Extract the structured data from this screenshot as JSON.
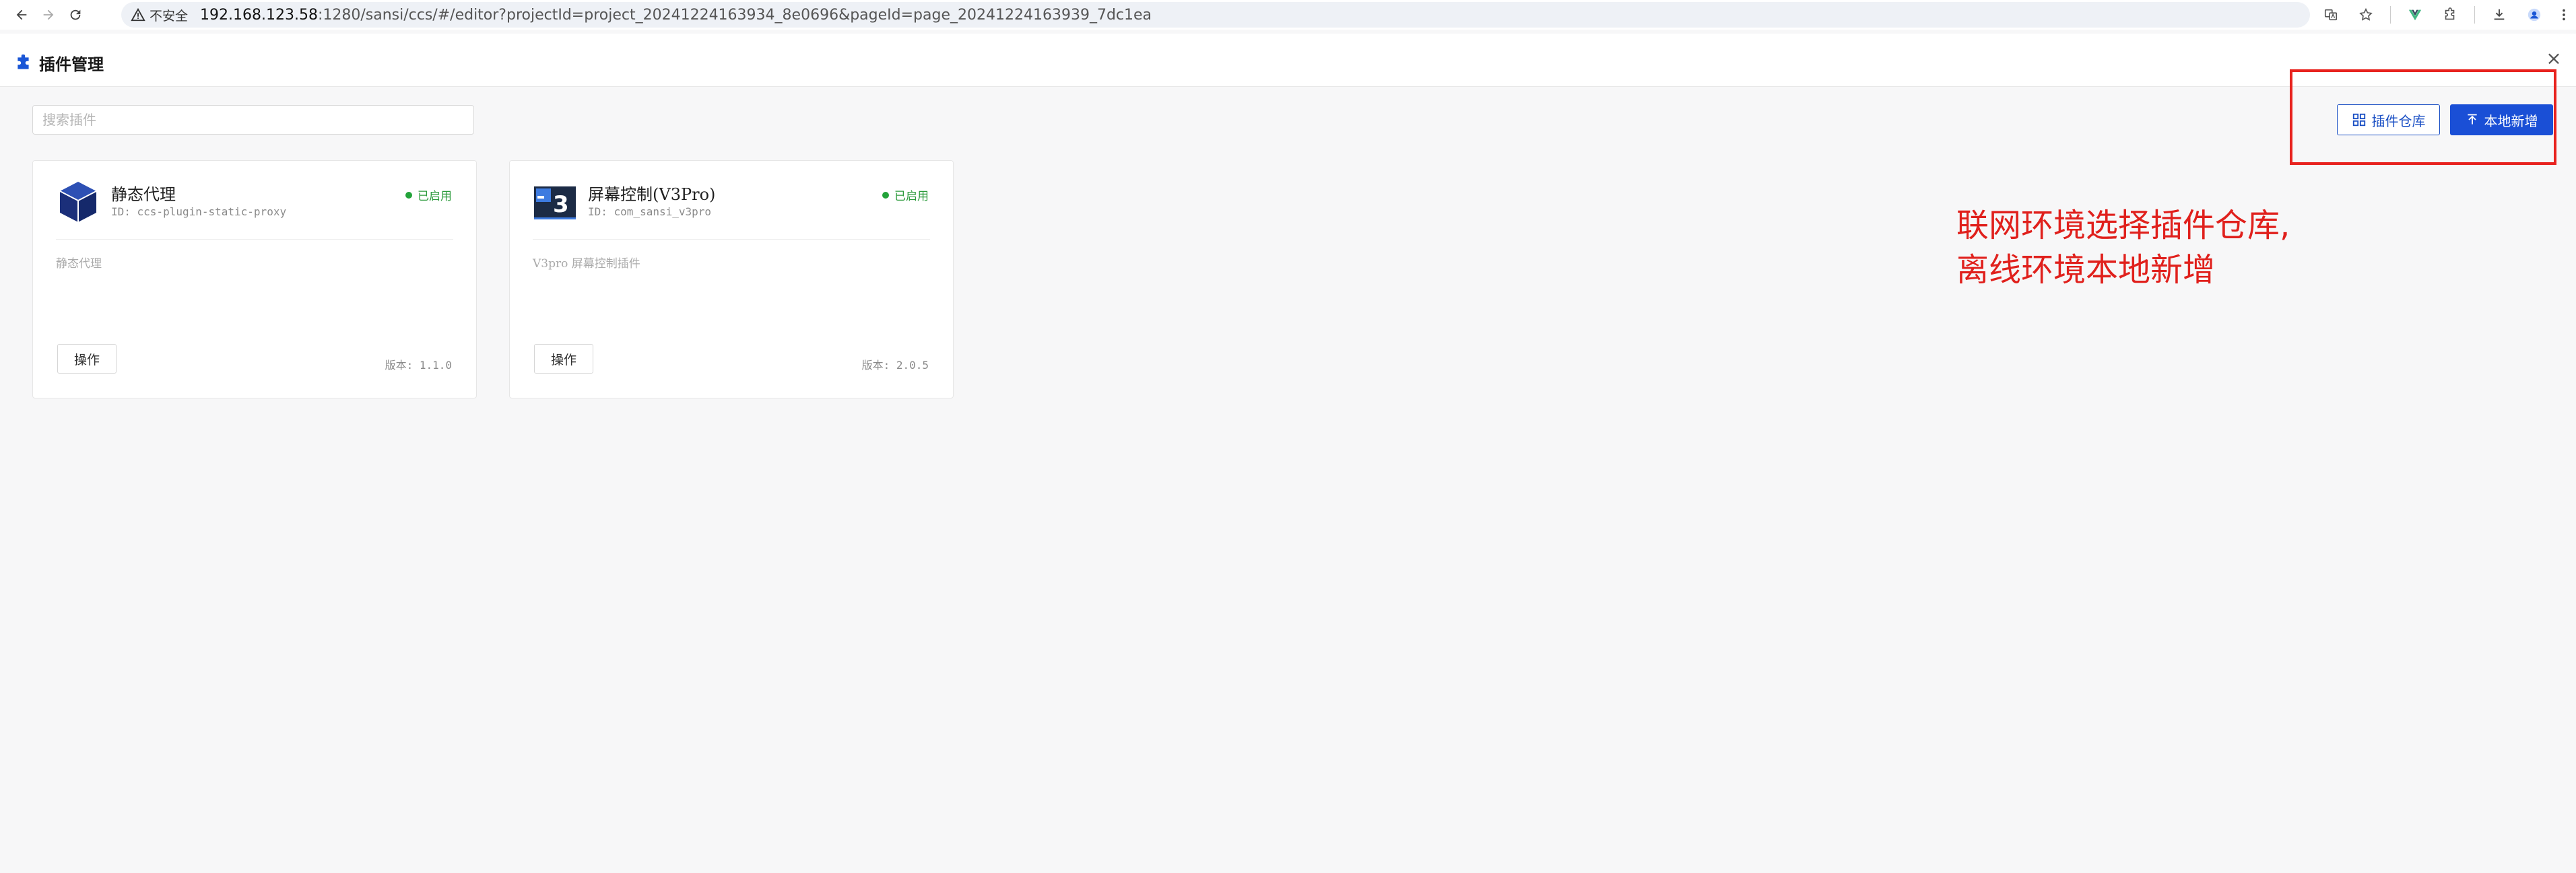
{
  "browser": {
    "security_label": "不安全",
    "url_host": "192.168.123.58",
    "url_rest": ":1280/sansi/ccs/#/editor?projectId=project_20241224163934_8e0696&pageId=page_20241224163939_7dc1ea"
  },
  "header": {
    "title": "插件管理",
    "close": "×"
  },
  "toolbar": {
    "search_placeholder": "搜索插件",
    "repo_button": "插件仓库",
    "add_button": "本地新增"
  },
  "annotation": {
    "line1": "联网环境选择插件仓库,",
    "line2": "离线环境本地新增",
    "color": "#e0201c"
  },
  "plugins": [
    {
      "name": "静态代理",
      "id": "ID: ccs-plugin-static-proxy",
      "status": "已启用",
      "description": "静态代理",
      "action": "操作",
      "version": "版本: 1.1.0",
      "icon": "cube-icon"
    },
    {
      "name": "屏幕控制(V3Pro)",
      "id": "ID: com_sansi_v3pro",
      "status": "已启用",
      "description": "V3pro 屏幕控制插件",
      "action": "操作",
      "version": "版本: 2.0.5",
      "icon": "v3-screen-icon"
    }
  ],
  "colors": {
    "primary": "#1a4fd6",
    "status_enabled": "#23a33a",
    "annotation_red": "#e8231f"
  }
}
